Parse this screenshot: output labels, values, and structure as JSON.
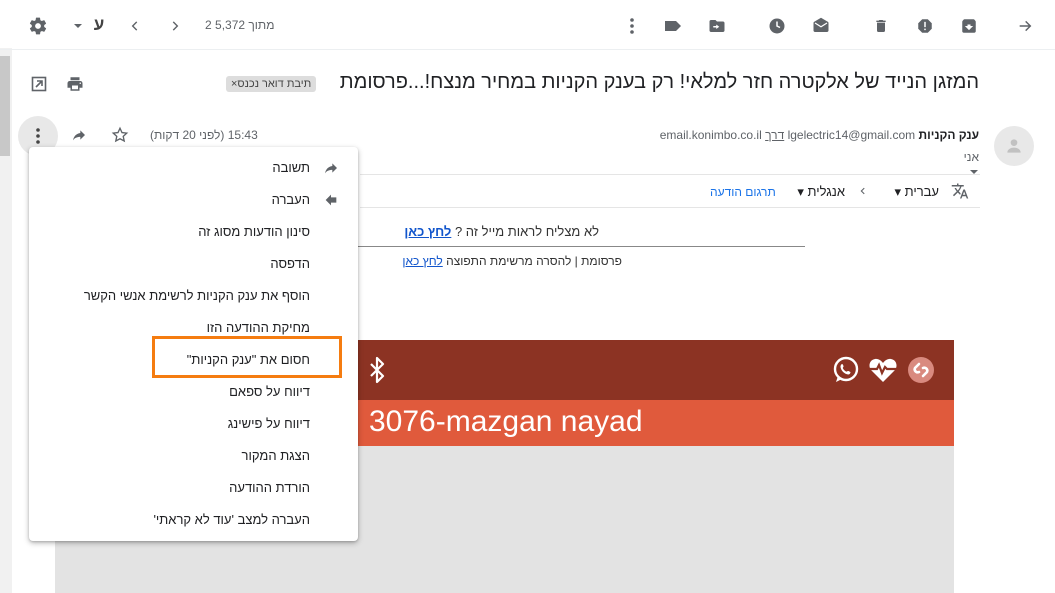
{
  "toolbar": {
    "page_info": "2 מתוך 5,372",
    "input_language": "ע"
  },
  "subject": {
    "text": "המזגן הנייד של אלקטרה חזר למלאי! רק בענק הקניות במחיר מנצח!...פרסומת",
    "label_badge": "תיבת דואר נכנס×"
  },
  "sender": {
    "name": "ענק הקניות",
    "email": "lgelectric14@gmail.com",
    "via_label": "דרך",
    "via_domain": "email.konimbo.co.il",
    "to": "אני",
    "time": "15:43 (לפני 20 דקות)"
  },
  "translate_bar": {
    "source_lang": "עברית",
    "target_lang": "אנגלית",
    "translate_link": "תרגום הודעה"
  },
  "body": {
    "notice_text": "לא מצליח לראות מייל זה ?",
    "notice_link": "לחץ כאן",
    "unsub_text": "פרסומת | להסרה מרשימת התפוצה",
    "unsub_link": "לחץ כאן",
    "banner_title": "3076-mazgan nayad"
  },
  "menu": {
    "items": [
      "תשובה",
      "העברה",
      "סינון הודעות מסוג זה",
      "הדפסה",
      "הוסף את ענק הקניות לרשימת אנשי הקשר",
      "מחיקת ההודעה הזו",
      "חסום את \"ענק הקניות\"",
      "דיווח על ספאם",
      "דיווח על פישינג",
      "הצגת המקור",
      "הורדת ההודעה",
      "העברה למצב 'עוד לא קראתי'"
    ]
  },
  "colors": {
    "highlight": "#f57c10",
    "banner_dark": "#8c3323",
    "banner_orange": "#e05a3c",
    "link": "#1155cc"
  }
}
